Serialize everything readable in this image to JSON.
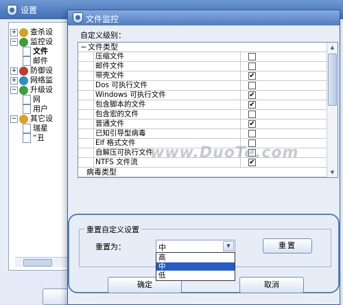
{
  "back_window": {
    "title": "设置",
    "tree": [
      {
        "exp": "+",
        "label": "查杀设",
        "icon": "search-shield-icon",
        "color": "#d9a020",
        "level": 0
      },
      {
        "exp": "−",
        "label": "监控设",
        "icon": "umbrella-icon",
        "color": "#3f9e3a",
        "level": 0
      },
      {
        "exp": "",
        "label": "文件",
        "icon": "document-icon",
        "color": "#ffffff",
        "level": 1,
        "bold": true
      },
      {
        "exp": "",
        "label": "邮件",
        "icon": "document-icon",
        "color": "#ffffff",
        "level": 1
      },
      {
        "exp": "+",
        "label": "防御设",
        "icon": "shield-icon",
        "color": "#c23a2b",
        "level": 0
      },
      {
        "exp": "+",
        "label": "网络监",
        "icon": "globe-icon",
        "color": "#2a8fc5",
        "level": 0
      },
      {
        "exp": "−",
        "label": "升级设",
        "icon": "update-icon",
        "color": "#3ca03c",
        "level": 0
      },
      {
        "exp": "",
        "label": "网",
        "icon": "document-icon",
        "color": "#ffffff",
        "level": 1
      },
      {
        "exp": "",
        "label": "用户",
        "icon": "document-icon",
        "color": "#ffffff",
        "level": 1
      },
      {
        "exp": "−",
        "label": "其它设",
        "icon": "gear-icon",
        "color": "#e0a020",
        "level": 0
      },
      {
        "exp": "",
        "label": "瑞星",
        "icon": "document-icon",
        "color": "#ffffff",
        "level": 1
      },
      {
        "exp": "",
        "label": "“丑",
        "icon": "document-icon",
        "color": "#ffffff",
        "level": 1
      }
    ],
    "button": ""
  },
  "dialog": {
    "title": "文件监控",
    "level_label": "自定义级别：",
    "list": {
      "category1": "文件类型",
      "rows": [
        {
          "label": "压缩文件",
          "checked": false
        },
        {
          "label": "邮件文件",
          "checked": false
        },
        {
          "label": "带壳文件",
          "checked": true
        },
        {
          "label": "Dos 可执行文件",
          "checked": false
        },
        {
          "label": "Windows 可执行文件",
          "checked": true
        },
        {
          "label": "包含脚本的文件",
          "checked": true
        },
        {
          "label": "包含宏的文件",
          "checked": false
        },
        {
          "label": "普通文件",
          "checked": true
        },
        {
          "label": "已知引导型病毒",
          "checked": false
        },
        {
          "label": "Elf 格式文件",
          "checked": false
        },
        {
          "label": "自解压可执行文件",
          "checked": false
        },
        {
          "label": "NTFS 文件流",
          "checked": true
        }
      ],
      "category2": "病毒类型",
      "check_mark": "✔",
      "collapse": "−",
      "scroll_up": "▲",
      "scroll_down": "▼"
    },
    "group": {
      "legend": "重置自定义设置",
      "reset_label": "重置为：",
      "combo_value": "中",
      "combo_arrow": "▼",
      "options": [
        "高",
        "中",
        "低"
      ],
      "selected": "中",
      "reset_button": "重置"
    },
    "ok_button": "确定",
    "cancel_button": "取消"
  },
  "watermark": "www.DuoTe.com",
  "colors": {
    "titlebar": "#4f7cc0",
    "selection": "#245ec4",
    "panel_border": "#5a7fb8"
  }
}
